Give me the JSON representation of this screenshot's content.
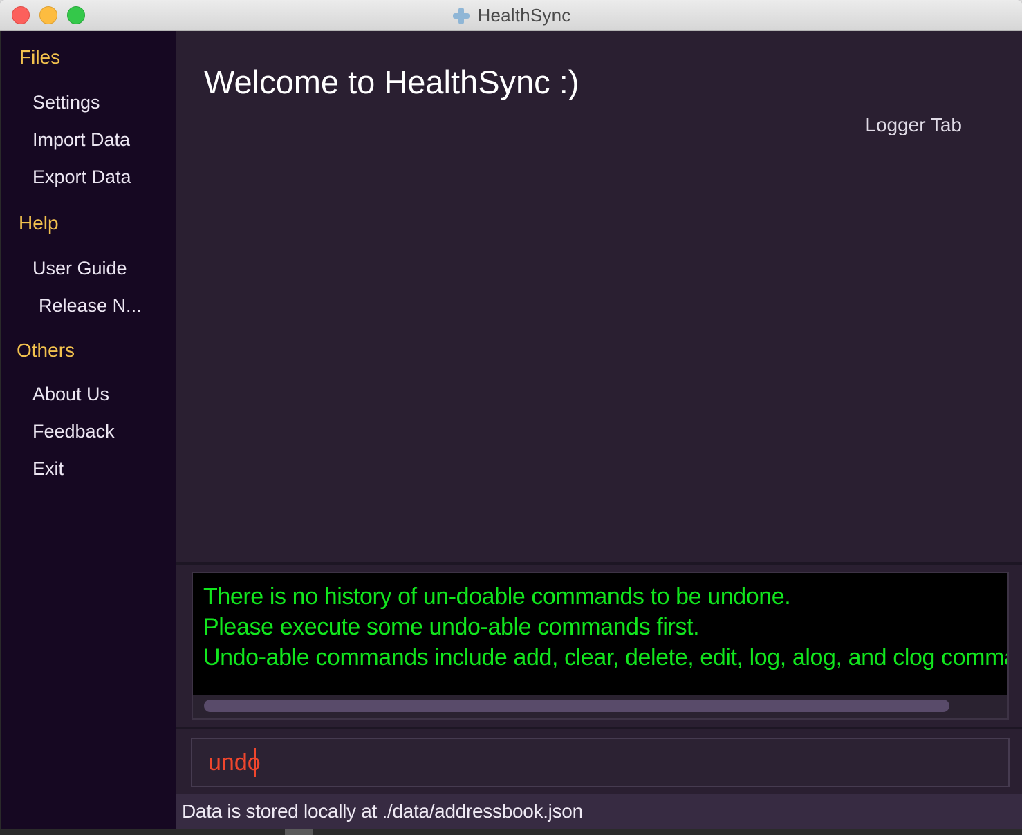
{
  "window": {
    "title": "HealthSync",
    "app_icon": "medical-cross-icon"
  },
  "sidebar": {
    "sections": [
      {
        "header": "Files",
        "items": [
          "Settings",
          "Import Data",
          "Export Data"
        ]
      },
      {
        "header": "Help",
        "items": [
          "User Guide",
          "Release N..."
        ]
      },
      {
        "header": "Others",
        "items": [
          "About Us",
          "Feedback",
          "Exit"
        ]
      }
    ]
  },
  "main": {
    "welcome": "Welcome to HealthSync :)",
    "logger_tab": "Logger Tab"
  },
  "result": {
    "lines": [
      "There is no history of un-doable commands to be undone.",
      "Please execute some undo-able commands first.",
      "Undo-able commands include add, clear, delete, edit, log, alog, and clog commands."
    ]
  },
  "command": {
    "value": "undo"
  },
  "status": {
    "text": "Data is stored locally at ./data/addressbook.json"
  },
  "colors": {
    "accent_header": "#f2c14e",
    "result_text": "#12e61e",
    "command_text": "#f0462d",
    "sidebar_bg": "#160822",
    "main_bg": "#2a1f31"
  }
}
